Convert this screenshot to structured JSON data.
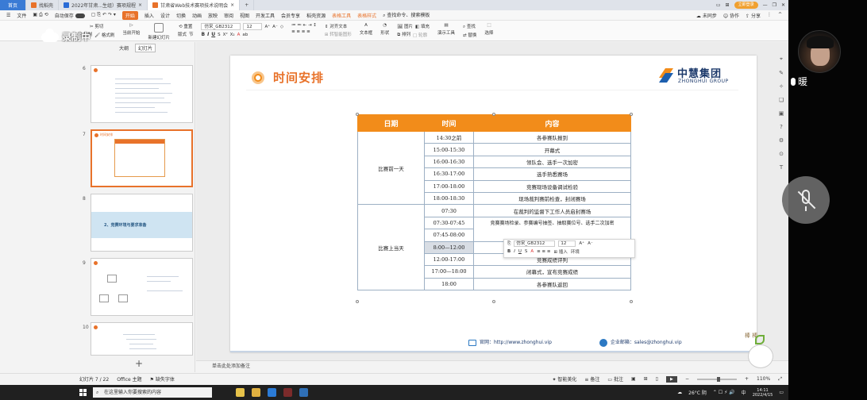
{
  "titlebar": {
    "tabs": [
      {
        "label": "首页",
        "kind": "home"
      },
      {
        "label": "找稻壳",
        "kind": "normal"
      },
      {
        "label": "2022年甘肃...生组）赛项规程",
        "kind": "normal"
      },
      {
        "label": "甘肃省Web技术赛项技术说明会",
        "kind": "active"
      }
    ],
    "login": "立即登录"
  },
  "menubar": {
    "file": "文件",
    "autosave": "自动保存",
    "items": [
      "开始",
      "插入",
      "设计",
      "切换",
      "动画",
      "放映",
      "审阅",
      "视图",
      "开发工具",
      "会员专享",
      "稻壳资源"
    ],
    "tool_tabs": [
      "表格工具",
      "表格样式"
    ],
    "search": "查找命令、搜索模板",
    "right": [
      "未同步",
      "协作",
      "分享"
    ]
  },
  "ribbon": {
    "groups": [
      "剪切",
      "复制",
      "格式刷",
      "当前开始",
      "新建幻灯片",
      "版式",
      "节",
      "重置"
    ],
    "font_name": "仿宋_GB2312",
    "font_size": "12",
    "text_format": "文本框",
    "shape": "形状",
    "arrange": "排列",
    "find": "查找",
    "replace": "替换",
    "select": "选择",
    "presentation_tools": "演示工具",
    "picture": "图片",
    "fill": "填充",
    "text_tools": "文字工具",
    "outline": "轮廓",
    "smart_graphics": "转智能图形",
    "align": "对齐文本"
  },
  "recording": {
    "label": "录制中"
  },
  "leftpanel": {
    "tabs": [
      "大纲",
      "幻灯片"
    ],
    "slides": [
      {
        "num": "6",
        "kind": "list"
      },
      {
        "num": "7",
        "kind": "table",
        "selected": true,
        "title": "时间安排"
      },
      {
        "num": "8",
        "kind": "section",
        "band_text": "2、竞赛环境与要求准备"
      },
      {
        "num": "9",
        "kind": "diagram"
      },
      {
        "num": "10",
        "kind": "list2"
      }
    ],
    "add": "+"
  },
  "slide": {
    "title": "时间安排",
    "logo_cn": "中慧集团",
    "logo_en": "ZHONGHUI GROUP",
    "table": {
      "headers": [
        "日期",
        "时间",
        "内容"
      ],
      "groups": [
        {
          "date": "比赛前一天",
          "rows": [
            {
              "time": "14:30之前",
              "content": "各参赛队报到"
            },
            {
              "time": "15:00-15:30",
              "content": "开幕式"
            },
            {
              "time": "16:00-16:30",
              "content": "领队会、选手一次加密"
            },
            {
              "time": "16:30-17:00",
              "content": "选手熟悉赛场"
            },
            {
              "time": "17:00-18:00",
              "content": "竞赛现场设备调试检验"
            },
            {
              "time": "18:00-18:30",
              "content": "现场裁判赛前检查，封闭赛场"
            }
          ]
        },
        {
          "date": "比赛上当天",
          "rows": [
            {
              "time": "07:30",
              "content": "在裁判的监督下工作人员启封赛场"
            },
            {
              "time": "07:30-07:45",
              "content": "竞赛赛场检录、参赛编号抽签、抽取赛位号、选手二次加密"
            },
            {
              "time": "07:45-08:00",
              "content": ""
            },
            {
              "time": "8:00—12:00",
              "content": "参赛选手完成竞赛任务、提交、封署和运行",
              "highlight": true
            },
            {
              "time": "12:00-17:00",
              "content": "竞赛成绩评判"
            },
            {
              "time": "17:00—18:00",
              "content": "闭幕式，宣布竞赛成绩"
            },
            {
              "time": "18:00",
              "content": "各参赛队返回"
            }
          ]
        }
      ]
    },
    "footer": {
      "website": "官网：http://www.zhonghui.vip",
      "email": "企业邮箱：sales@zhonghui.vip"
    }
  },
  "floatbar": {
    "font_name": "仿宋_GB2312",
    "font_size": "12",
    "insert": "插入",
    "ring": "环境"
  },
  "notes": {
    "placeholder": "单击此处添加备注"
  },
  "statusbar": {
    "slide_counter": "幻灯片 7 / 22",
    "theme": "Office 主题",
    "font_missing": "缺失字体",
    "smart_beautify": "智能美化",
    "notes": "备注",
    "comments": "批注",
    "zoom": "110%"
  },
  "taskbar": {
    "search_placeholder": "在这里输入你要搜索的内容",
    "weather": "26°C 阴",
    "ime": "中",
    "time": "14:11",
    "date": "2022/4/15"
  },
  "overlay": {
    "username": "暖",
    "sticker_text": "棒 棒"
  }
}
